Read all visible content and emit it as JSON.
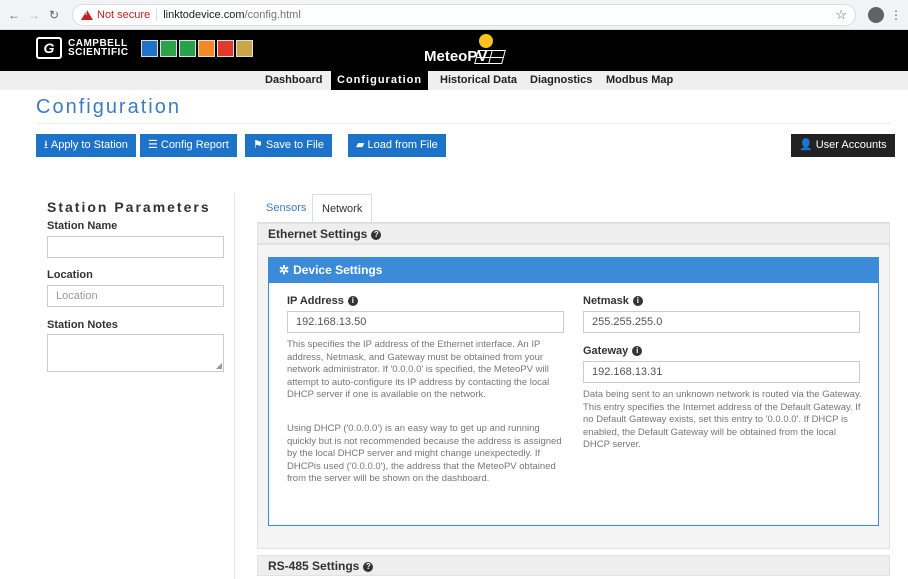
{
  "browser": {
    "security_label": "Not secure",
    "url_host": "linktodevice.com",
    "url_path": "/config.html"
  },
  "header": {
    "company_line1": "CAMPBELL",
    "company_line2": "SCIENTIFIC",
    "product_name": "MeteoPV"
  },
  "nav": {
    "tabs": [
      {
        "label": "Dashboard"
      },
      {
        "label": "Configuration"
      },
      {
        "label": "Historical Data"
      },
      {
        "label": "Diagnostics"
      },
      {
        "label": "Modbus Map"
      }
    ],
    "active": "Configuration"
  },
  "page": {
    "title": "Configuration"
  },
  "toolbar": {
    "apply": "Apply to Station",
    "config_report": "Config Report",
    "save_file": "Save to File",
    "load_file": "Load from File",
    "user_accounts": "User Accounts"
  },
  "station": {
    "title": "Station Parameters",
    "name_label": "Station Name",
    "name_value": "",
    "location_label": "Location",
    "location_placeholder": "Location",
    "notes_label": "Station Notes",
    "notes_value": ""
  },
  "tabs": {
    "sensors": "Sensors",
    "network": "Network"
  },
  "ethernet": {
    "title": "Ethernet Settings",
    "card_title": "Device Settings",
    "ip_label": "IP Address",
    "ip_value": "192.168.13.50",
    "ip_help1": "This specifies the IP address of the Ethernet interface. An IP address, Netmask, and Gateway must be obtained from your network administrator. If '0.0.0.0' is specified, the MeteoPV will attempt to auto-configure its IP address by contacting the local DHCP server if one is available on the network.",
    "ip_help2": "Using DHCP ('0.0.0.0') is an easy way to get up and running quickly but is not recommended because the address is assigned by the local DHCP server and might change unexpectedly. If DHCPis used ('0.0.0.0'), the address that the MeteoPV obtained from the server will be shown on the dashboard.",
    "netmask_label": "Netmask",
    "netmask_value": "255.255.255.0",
    "gateway_label": "Gateway",
    "gateway_value": "192.168.13.31",
    "gateway_help": "Data being sent to an unknown network is routed via the Gateway. This entry specifies the Internet address of the Default Gateway. If no Default Gateway exists, set this entry to '0.0.0.0'. If DHCP is enabled, the Default Gateway will be obtained from the local DHCP server."
  },
  "rs485": {
    "title": "RS-485 Settings"
  },
  "colors": {
    "primary": "#1c73c8",
    "title_blue": "#3e7cc4",
    "card_blue": "#3c8bd9",
    "header_black": "#000000"
  }
}
